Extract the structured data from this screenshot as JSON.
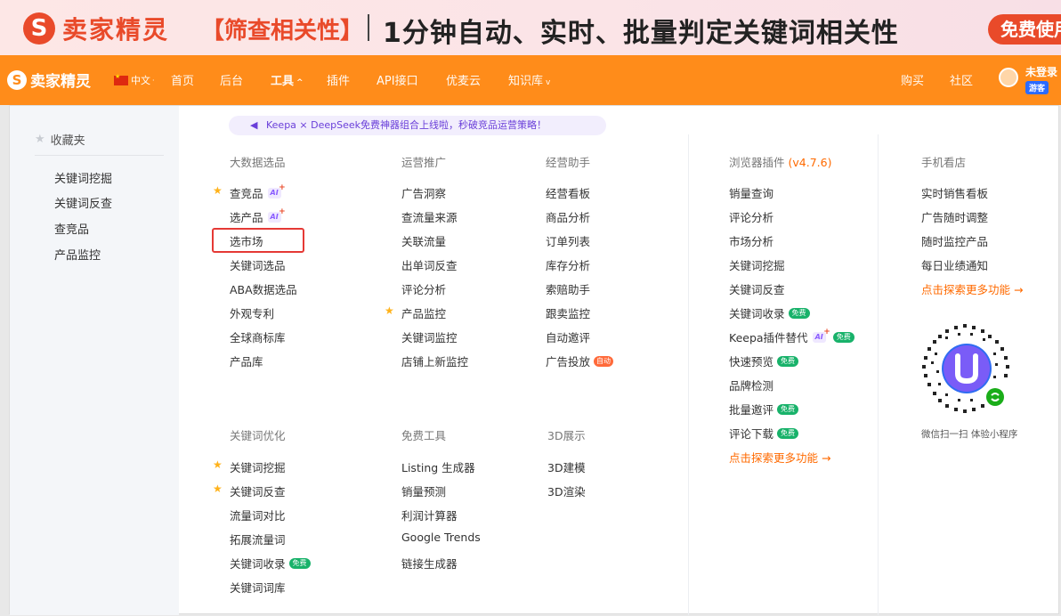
{
  "banner": {
    "logo_mark": "S",
    "logo_text": "卖家精灵",
    "tag": "【筛查相关性】",
    "title": "1分钟自动、实时、批量判定关键词相关性",
    "cta": "免费使用"
  },
  "nav": {
    "logo_mark": "S",
    "logo_text": "卖家精灵",
    "lang": "中文",
    "items": [
      "首页",
      "后台",
      "工具",
      "插件",
      "API接口",
      "优麦云",
      "知识库"
    ],
    "right_items": [
      "购买",
      "社区"
    ],
    "user_status": "未登录",
    "user_badge": "游客"
  },
  "sidebar": {
    "title": "收藏夹",
    "items": [
      "关键词挖掘",
      "关键词反查",
      "查竞品",
      "产品监控"
    ]
  },
  "promo": "Keepa × DeepSeek免费神器组合上线啦，秒破竞品运营策略！",
  "columns": {
    "big_data": {
      "title": "大数据选品",
      "items": [
        "查竞品",
        "选产品",
        "选市场",
        "关键词选品",
        "ABA数据选品",
        "外观专利",
        "全球商标库",
        "产品库"
      ]
    },
    "ops": {
      "title": "运营推广",
      "items": [
        "广告洞察",
        "查流量来源",
        "关联流量",
        "出单词反查",
        "评论分析",
        "产品监控",
        "关键词监控",
        "店铺上新监控"
      ]
    },
    "assist": {
      "title": "经营助手",
      "items": [
        "经营看板",
        "商品分析",
        "订单列表",
        "库存分析",
        "索赔助手",
        "跟卖监控",
        "自动邀评",
        "广告投放"
      ]
    },
    "keyword_opt": {
      "title": "关键词优化",
      "items": [
        "关键词挖掘",
        "关键词反查",
        "流量词对比",
        "拓展流量词",
        "关键词收录",
        "关键词词库"
      ]
    },
    "free_tools": {
      "title": "免费工具",
      "items": [
        "Listing 生成器",
        "销量预测",
        "利润计算器",
        "Google Trends",
        "链接生成器"
      ]
    },
    "d3": {
      "title": "3D展示",
      "items": [
        "3D建模",
        "3D渲染"
      ]
    },
    "plugin": {
      "title": "浏览器插件",
      "version": "(v4.7.6)",
      "items": [
        "销量查询",
        "评论分析",
        "市场分析",
        "关键词挖掘",
        "关键词反查",
        "关键词收录",
        "Keepa插件替代",
        "快速预览",
        "品牌检测",
        "批量邀评",
        "评论下载"
      ],
      "more": "点击探索更多功能 →"
    },
    "mobile": {
      "title": "手机看店",
      "items": [
        "实时销售看板",
        "广告随时调整",
        "随时监控产品",
        "每日业绩通知"
      ],
      "more": "点击探索更多功能 →",
      "qr_caption": "微信扫一扫 体验小程序"
    }
  },
  "badges": {
    "ai": "AI",
    "free": "免费",
    "auto": "自动"
  },
  "colors": {
    "brand_orange": "#ff8c1a",
    "brand_red": "#e94a2a",
    "link_orange": "#ff6a00",
    "highlight": "#e53935"
  }
}
